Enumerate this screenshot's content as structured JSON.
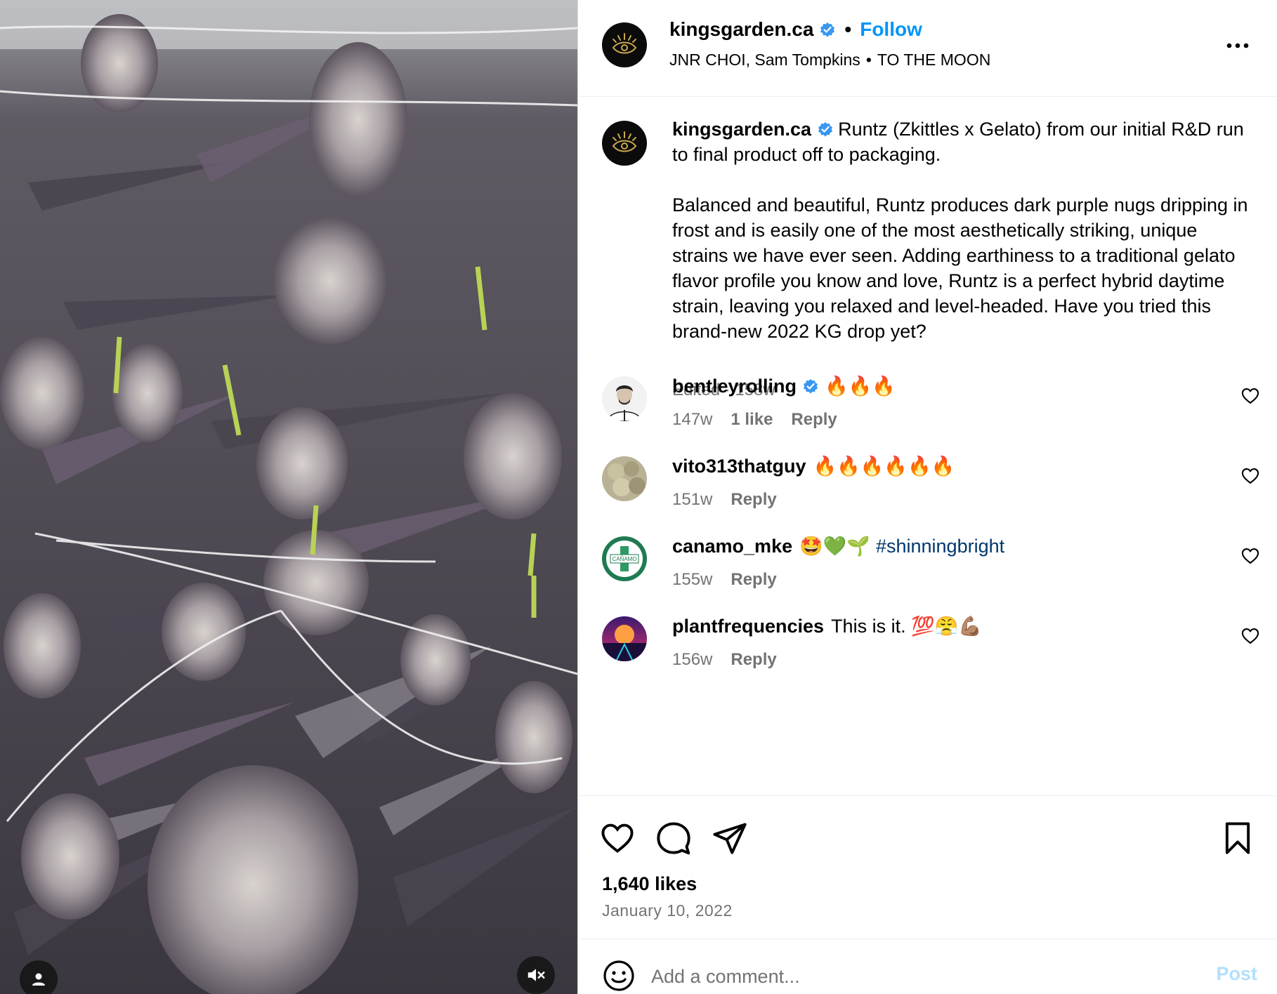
{
  "colors": {
    "accent": "#0095f6",
    "muted": "#737373",
    "verified": "#3897f0",
    "hashtag": "#00376b"
  },
  "header": {
    "username": "kingsgarden.ca",
    "separator": "•",
    "follow_label": "Follow",
    "audio_artists": "JNR CHOI, Sam Tompkins",
    "audio_separator": "•",
    "audio_track": "TO THE MOON",
    "more_icon": "more-horizontal-icon"
  },
  "caption": {
    "username": "kingsgarden.ca",
    "line1": "Runtz (Zkittles x Gelato) from our initial R&D run to final product off to packaging.",
    "line2": "Balanced and beautiful, Runtz produces dark purple nugs dripping in frost and is easily one of the most aesthetically striking, unique strains we have ever seen. Adding earthiness to a traditional gelato flavor profile you know and love, Runtz is a perfect hybrid daytime strain, leaving you relaxed and level-headed. Have you tried this brand-new 2022 KG drop yet?",
    "meta": "Edited · 158w"
  },
  "comments": [
    {
      "username": "bentleyrolling",
      "verified": true,
      "text": "🔥🔥🔥",
      "time": "147w",
      "likes": "1 like",
      "reply": "Reply"
    },
    {
      "username": "vito313thatguy",
      "verified": false,
      "text": "🔥🔥🔥🔥🔥🔥",
      "time": "151w",
      "likes": "",
      "reply": "Reply"
    },
    {
      "username": "canamo_mke",
      "verified": false,
      "text": "🤩💚🌱",
      "hashtag": "#shinningbright",
      "avatar_text": "CAÑAMO",
      "time": "155w",
      "likes": "",
      "reply": "Reply"
    },
    {
      "username": "plantfrequencies",
      "verified": false,
      "text": "This is it. 💯😤💪🏽",
      "time": "156w",
      "likes": "",
      "reply": "Reply"
    }
  ],
  "actions": {
    "likes": "1,640 likes",
    "date": "January 10, 2022"
  },
  "add_comment": {
    "placeholder": "Add a comment...",
    "post_label": "Post"
  }
}
